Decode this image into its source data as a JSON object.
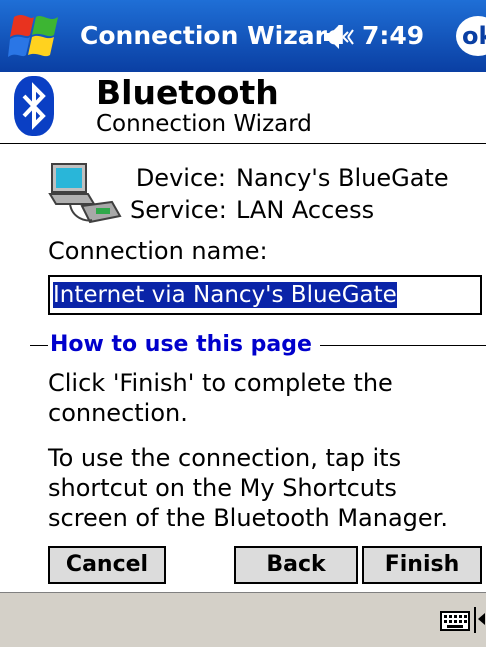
{
  "titlebar": {
    "title": "Connection Wizard",
    "time": "7:49",
    "ok_label": "ok",
    "icons": [
      "start-flag-icon",
      "volume-icon"
    ]
  },
  "header": {
    "title": "Bluetooth",
    "subtitle": "Connection Wizard",
    "icon": "bluetooth-icon"
  },
  "device": {
    "device_label": "Device:",
    "device_value": "Nancy's BlueGate",
    "service_label": "Service:",
    "service_value": "LAN Access",
    "icon": "computer-network-icon"
  },
  "connection": {
    "label": "Connection name:",
    "value": "Internet via Nancy's BlueGate"
  },
  "howto": {
    "title": "How to use this page",
    "para1": "Click 'Finish' to complete the connection.",
    "para2": "To use the connection, tap its shortcut on the My Shortcuts screen of the Bluetooth Manager."
  },
  "buttons": {
    "cancel": "Cancel",
    "back": "Back",
    "finish": "Finish"
  },
  "taskbar": {
    "icons": [
      "keyboard-icon",
      "input-menu-arrow-icon"
    ]
  },
  "colors": {
    "titlebar": "#0a3fa3",
    "selection": "#0a24a8",
    "howto_title": "#0000cc",
    "button_face": "#dcdcdc",
    "taskbar": "#d4d0c8"
  }
}
